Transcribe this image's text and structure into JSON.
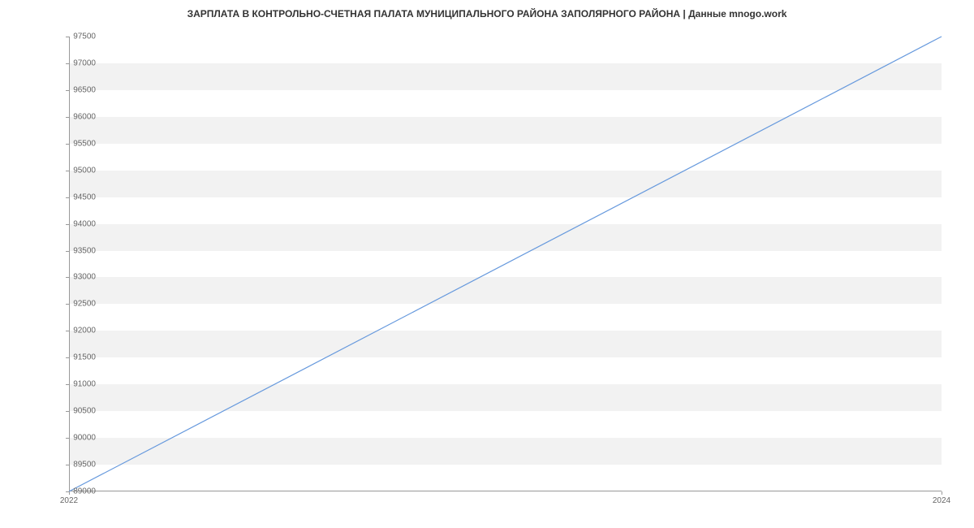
{
  "chart_data": {
    "type": "line",
    "title": "ЗАРПЛАТА В КОНТРОЛЬНО-СЧЕТНАЯ ПАЛАТА МУНИЦИПАЛЬНОГО РАЙОНА ЗАПОЛЯРНОГО РАЙОНА | Данные mnogo.work",
    "x": [
      2022,
      2024
    ],
    "values": [
      89000,
      97500
    ],
    "xlabel": "",
    "ylabel": "",
    "xlim": [
      2022,
      2024
    ],
    "ylim": [
      89000,
      97500
    ],
    "y_ticks": [
      89000,
      89500,
      90000,
      90500,
      91000,
      91500,
      92000,
      92500,
      93000,
      93500,
      94000,
      94500,
      95000,
      95500,
      96000,
      96500,
      97000,
      97500
    ],
    "x_ticks": [
      2022,
      2024
    ],
    "line_color": "#6699dd",
    "band_color": "#f2f2f2"
  }
}
